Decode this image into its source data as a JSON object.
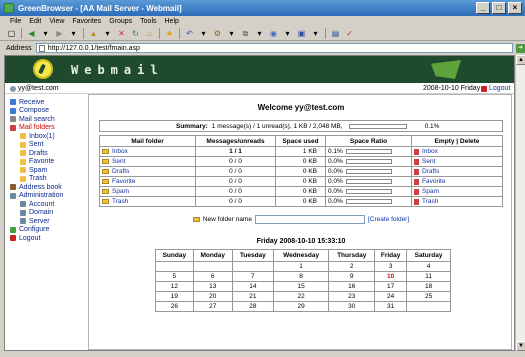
{
  "window": {
    "title": "GreenBrowser - [AA Mail Server - Webmail]"
  },
  "menu": [
    "File",
    "Edit",
    "View",
    "Favorites",
    "Groups",
    "Tools",
    "Help"
  ],
  "address": {
    "label": "Address",
    "url": "http://127.0.0.1/test/fmain.asp"
  },
  "banner": {
    "wordmark": "Webmail"
  },
  "topline": {
    "user": "yy@test.com",
    "date": "2008-10-10 Friday",
    "logout": "Logout"
  },
  "sidebar": [
    {
      "label": "Receive",
      "color": "#3a7bd5",
      "red": false,
      "sub": false
    },
    {
      "label": "Compose",
      "color": "#3a7bd5",
      "red": false,
      "sub": false
    },
    {
      "label": "Mail search",
      "color": "#888888",
      "red": false,
      "sub": false
    },
    {
      "label": "Mail folders",
      "color": "#d04040",
      "red": true,
      "sub": false
    },
    {
      "label": "Inbox(1)",
      "color": "#f0c040",
      "red": false,
      "sub": true
    },
    {
      "label": "Sent",
      "color": "#f0c040",
      "red": false,
      "sub": true
    },
    {
      "label": "Drafts",
      "color": "#f0c040",
      "red": false,
      "sub": true
    },
    {
      "label": "Favorite",
      "color": "#f0c040",
      "red": false,
      "sub": true
    },
    {
      "label": "Spam",
      "color": "#f0c040",
      "red": false,
      "sub": true
    },
    {
      "label": "Trash",
      "color": "#f0c040",
      "red": false,
      "sub": true
    },
    {
      "label": "Address book",
      "color": "#8a5a2a",
      "red": false,
      "sub": false
    },
    {
      "label": "Administration",
      "color": "#6a8aa0",
      "red": false,
      "sub": false
    },
    {
      "label": "Account",
      "color": "#6a8aa0",
      "red": false,
      "sub": true
    },
    {
      "label": "Domain",
      "color": "#6a8aa0",
      "red": false,
      "sub": true
    },
    {
      "label": "Server",
      "color": "#6a8aa0",
      "red": false,
      "sub": true
    },
    {
      "label": "Configure",
      "color": "#40a040",
      "red": false,
      "sub": false
    },
    {
      "label": "Logout",
      "color": "#cc2222",
      "red": false,
      "sub": false
    }
  ],
  "main": {
    "welcome": "Welcome yy@test.com",
    "summary": {
      "label": "Summary:",
      "text": "1 message(s) / 1 unread(s),  1 KB / 2,048 MB,",
      "fill": 0.001,
      "percent": "0.1%"
    },
    "folder_headers": [
      "Mail folder",
      "Messages/unreads",
      "Space used",
      "Space Ratio",
      "Empty | Delete"
    ],
    "folders": [
      {
        "name": "Inbox",
        "counts": "1 / 1",
        "bold": true,
        "size": "1 KB",
        "ratio": "0.1%",
        "fill": 0.001
      },
      {
        "name": "Sent",
        "counts": "0 / 0",
        "bold": false,
        "size": "0 KB",
        "ratio": "0.0%",
        "fill": 0
      },
      {
        "name": "Drafts",
        "counts": "0 / 0",
        "bold": false,
        "size": "0 KB",
        "ratio": "0.0%",
        "fill": 0
      },
      {
        "name": "Favorite",
        "counts": "0 / 0",
        "bold": false,
        "size": "0 KB",
        "ratio": "0.0%",
        "fill": 0
      },
      {
        "name": "Spam",
        "counts": "0 / 0",
        "bold": false,
        "size": "0 KB",
        "ratio": "0.0%",
        "fill": 0
      },
      {
        "name": "Trash",
        "counts": "0 / 0",
        "bold": false,
        "size": "0 KB",
        "ratio": "0.0%",
        "fill": 0
      }
    ],
    "new_folder": {
      "label": "New folder name",
      "value": "",
      "create": "[Create folder]"
    },
    "calendar": {
      "title": "Friday 2008-10-10 15:33:10",
      "days": [
        "Sunday",
        "Monday",
        "Tuesday",
        "Wednesday",
        "Thursday",
        "Friday",
        "Saturday"
      ],
      "weeks": [
        [
          "",
          "",
          "",
          "1",
          "2",
          "3",
          "4"
        ],
        [
          "5",
          "6",
          "7",
          "8",
          "9",
          "10",
          "11"
        ],
        [
          "12",
          "13",
          "14",
          "15",
          "16",
          "17",
          "18"
        ],
        [
          "19",
          "20",
          "21",
          "22",
          "23",
          "24",
          "25"
        ],
        [
          "26",
          "27",
          "28",
          "29",
          "30",
          "31",
          ""
        ]
      ],
      "today": "10"
    }
  }
}
